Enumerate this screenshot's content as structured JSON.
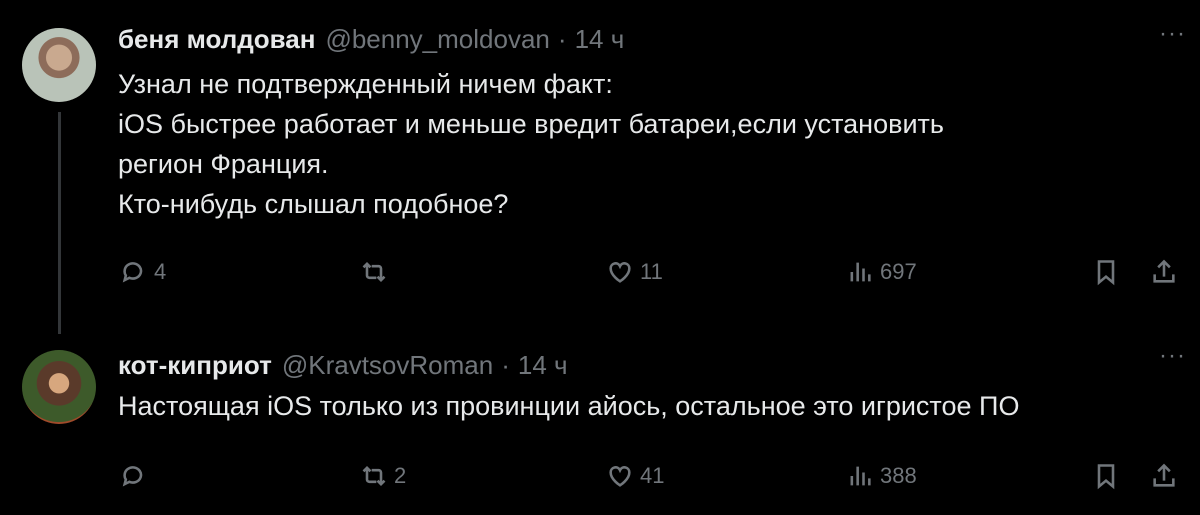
{
  "tweets": [
    {
      "author_name": "беня молдован",
      "handle": "@benny_moldovan",
      "separator": "·",
      "time": "14 ч",
      "more": "···",
      "lines": [
        "Узнал не подтвержденный ничем факт:",
        "iOS быстрее работает и меньше вредит батареи,если установить",
        "регион Франция.",
        "Кто-нибудь слышал подобное?"
      ],
      "replies": "4",
      "retweets": "",
      "likes": "11",
      "views": "697"
    },
    {
      "author_name": "кот-киприот",
      "handle": "@KravtsovRoman",
      "separator": "·",
      "time": "14 ч",
      "more": "···",
      "lines": [
        "Настоящая iOS только из провинции айось, остальное это игристое ПО"
      ],
      "replies": "",
      "retweets": "2",
      "likes": "41",
      "views": "388"
    }
  ],
  "icons": {
    "reply": "reply-icon",
    "retweet": "retweet-icon",
    "like": "like-icon",
    "views": "views-icon",
    "bookmark": "bookmark-icon",
    "share": "share-icon"
  },
  "colors": {
    "background": "#000000",
    "text": "#e7e9ea",
    "muted": "#71767b",
    "thread_line": "#333639"
  }
}
